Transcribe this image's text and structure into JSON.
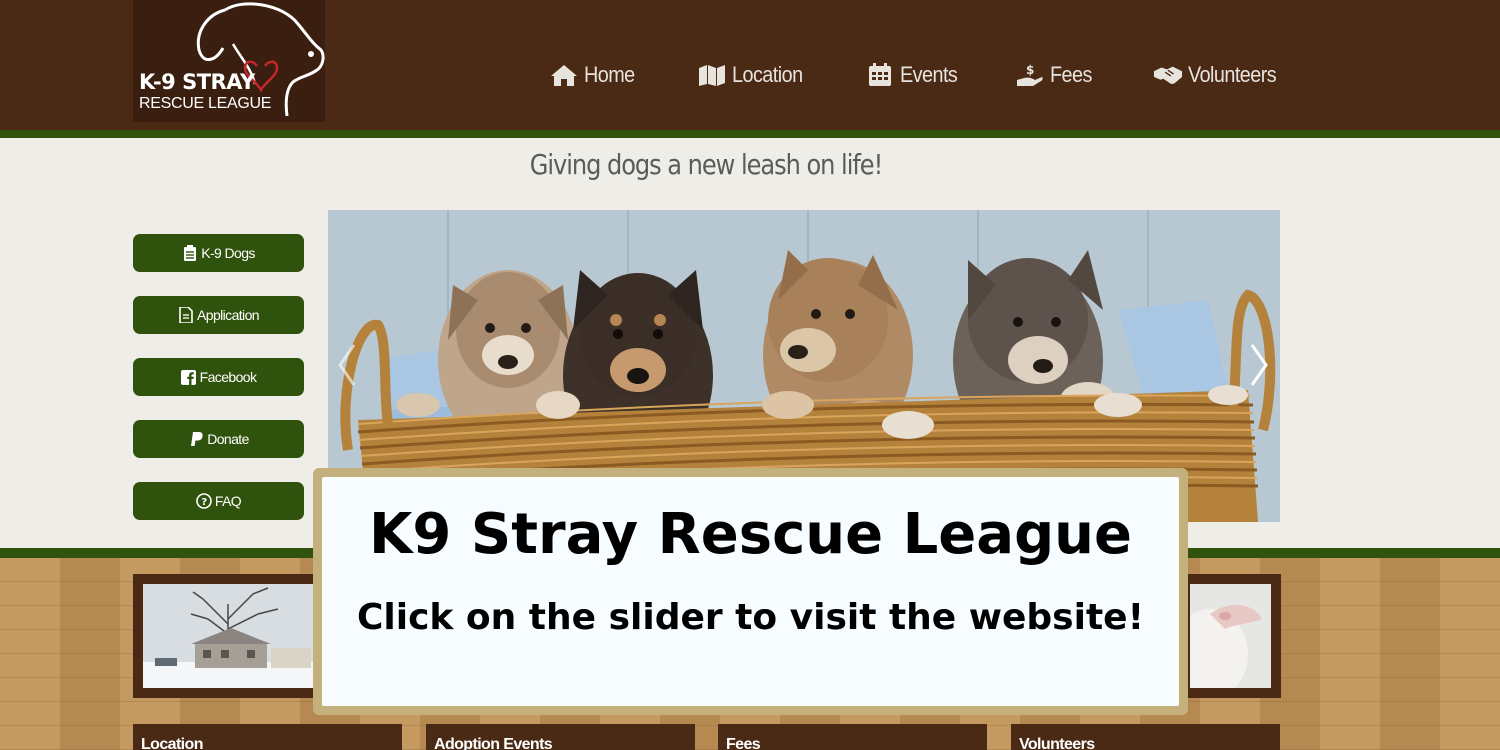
{
  "logo": {
    "line1": "K-9 STRAY",
    "line2": "RESCUE LEAGUE"
  },
  "nav": [
    {
      "label": "Home",
      "icon": "home-icon"
    },
    {
      "label": "Location",
      "icon": "map-icon"
    },
    {
      "label": "Events",
      "icon": "calendar-icon"
    },
    {
      "label": "Fees",
      "icon": "hand-dollar-icon"
    },
    {
      "label": "Volunteers",
      "icon": "handshake-icon"
    }
  ],
  "tagline": "Giving dogs a new leash on life!",
  "side_buttons": [
    {
      "label": "K-9 Dogs",
      "icon": "clipboard-icon"
    },
    {
      "label": "Application",
      "icon": "document-icon"
    },
    {
      "label": "Facebook",
      "icon": "facebook-icon"
    },
    {
      "label": "Donate",
      "icon": "paypal-icon"
    },
    {
      "label": "FAQ",
      "icon": "question-circle-icon"
    }
  ],
  "tiles": [
    {
      "label": "Location"
    },
    {
      "label": "Adoption Events"
    },
    {
      "label": "Fees"
    },
    {
      "label": "Volunteers"
    }
  ],
  "overlay": {
    "title": "K9 Stray Rescue League",
    "subtitle": "Click on the slider to visit the website!"
  },
  "colors": {
    "header_brown": "#4a2915",
    "accent_green": "#2f520c",
    "page_bg": "#efede8",
    "wood": "#bd9157",
    "overlay_border": "#c4b07c",
    "overlay_bg": "#f6fcff"
  }
}
